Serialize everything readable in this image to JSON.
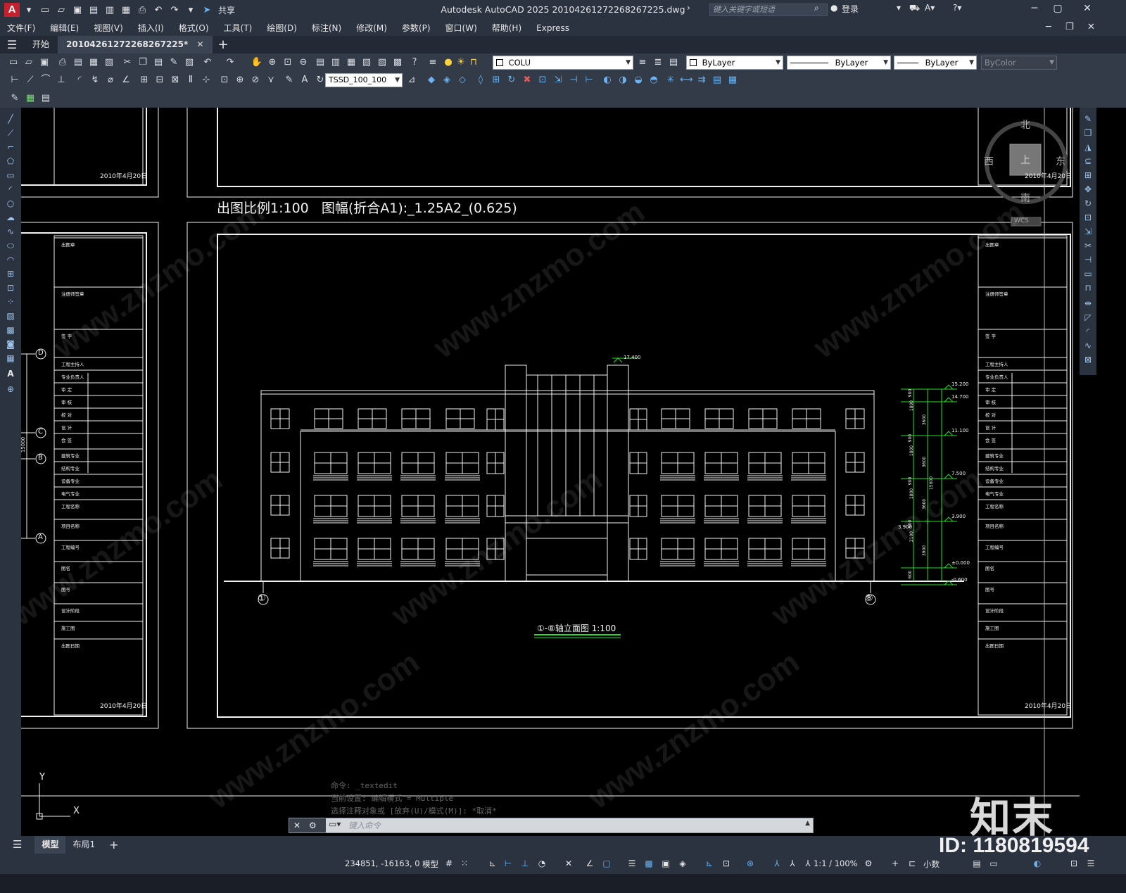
{
  "titlebar": {
    "app_logo": "A",
    "share": "共享",
    "title": "Autodesk AutoCAD 2025    2010426127226826​7225.dwg",
    "search_placeholder": "键入关键字或短语",
    "login": "登录"
  },
  "menu": [
    "文件(F)",
    "编辑(E)",
    "视图(V)",
    "插入(I)",
    "格式(O)",
    "工具(T)",
    "绘图(D)",
    "标注(N)",
    "修改(M)",
    "参数(P)",
    "窗口(W)",
    "帮助(H)",
    "Express"
  ],
  "tabs": {
    "start": "开始",
    "active_file": "20104261272268267225*"
  },
  "toolbar": {
    "layer": "COLU",
    "color": "ByLayer",
    "linetype": "ByLayer",
    "lineweight": "ByLayer",
    "plotstyle": "ByColor",
    "dimstyle": "TSSD_100_100"
  },
  "drawing": {
    "scale_note": "出图比例1:100   图幅(折合A1):_1.25A2_(0.625)",
    "elevation_title": "①-⑧轴立面图 1:100",
    "top_elev": "17.400",
    "date_stamp": "2010年4月20日",
    "axis_left": "①",
    "axis_right": "⑧",
    "grid_labels": [
      "D",
      "C",
      "B",
      "A"
    ],
    "left_dim": "15000",
    "right_levels": [
      "15.200",
      "14.700",
      "11.100",
      "7.500",
      "3.900",
      "±0.000",
      "-0.600"
    ],
    "right_dims": [
      "900",
      "1800",
      "3600",
      "900",
      "1800",
      "3600",
      "900",
      "1800",
      "3600",
      "900",
      "2100",
      "3900",
      "600"
    ],
    "right_total": "15000",
    "side_level": "3.900",
    "title_block_rows": [
      "出图章",
      "注册师签章",
      "签 字",
      "工程主持人",
      "专业负责人",
      "审 定",
      "审 核",
      "校 对",
      "设 计",
      "会 签",
      "建筑专业",
      "结构专业",
      "设备专业",
      "电气专业",
      "工程名称",
      "项目名称",
      "工程编号",
      "图名",
      "图号",
      "设计阶段",
      "施工图",
      "出图日期"
    ],
    "viewcube": {
      "north": "北",
      "south": "南",
      "east": "东",
      "west": "西",
      "top": "上",
      "wcs": "WCS"
    }
  },
  "command": {
    "history": [
      "命令: _textedit",
      "当前设置: 编辑模式 = Multiple",
      "选择注释对象或 [放弃(U)/模式(M)]: *取消*"
    ],
    "placeholder": "键入命令"
  },
  "layout_tabs": [
    "模型",
    "布局1"
  ],
  "status": {
    "coords": "234851, -16163, 0",
    "model": "模型",
    "scale": "1:1 / 100%",
    "units": "小数"
  },
  "watermark": {
    "logo": "知末",
    "id": "ID: 1180819594",
    "site": "www.znzmo.com"
  }
}
